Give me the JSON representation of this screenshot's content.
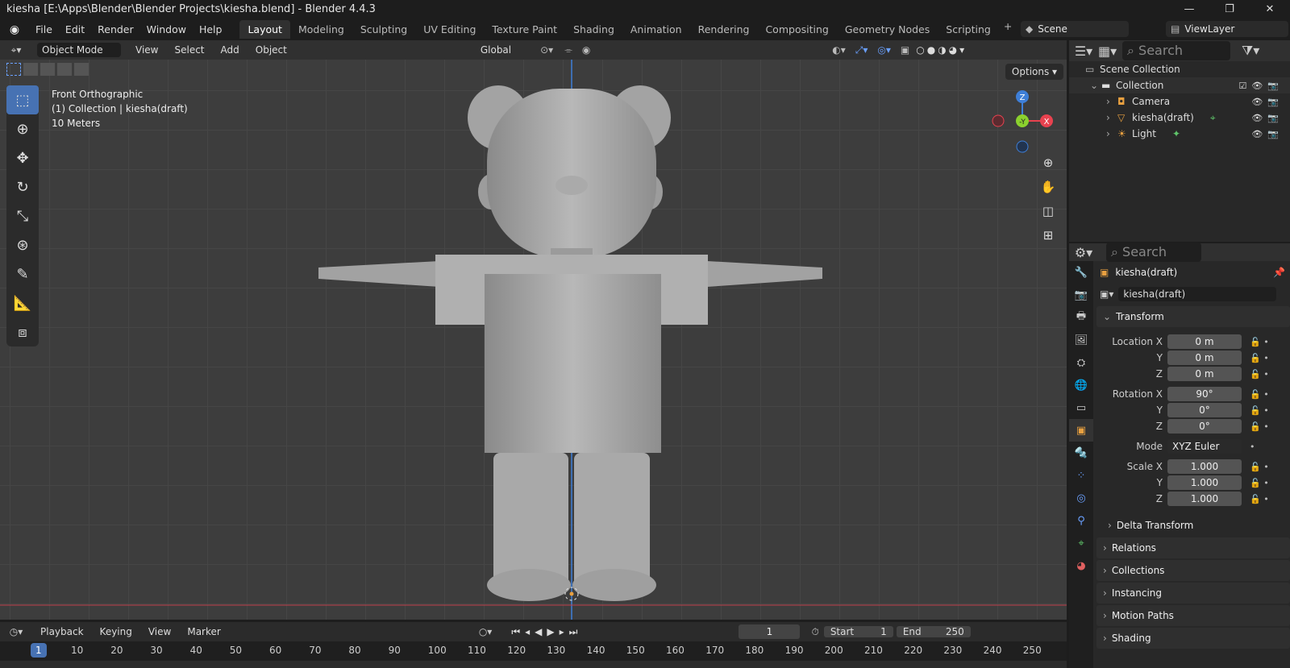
{
  "window": {
    "title": "kiesha [E:\\Apps\\Blender\\Blender Projects\\kiesha.blend] - Blender 4.4.3"
  },
  "menu": [
    "File",
    "Edit",
    "Render",
    "Window",
    "Help"
  ],
  "workspaces": [
    "Layout",
    "Modeling",
    "Sculpting",
    "UV Editing",
    "Texture Paint",
    "Shading",
    "Animation",
    "Rendering",
    "Compositing",
    "Geometry Nodes",
    "Scripting"
  ],
  "scene": "Scene",
  "view_layer": "ViewLayer",
  "viewport": {
    "mode": "Object Mode",
    "menus": [
      "View",
      "Select",
      "Add",
      "Object"
    ],
    "orientation": "Global",
    "options": "Options",
    "info": {
      "view": "Front Orthographic",
      "collection": "(1) Collection | kiesha(draft)",
      "scale": "10 Meters"
    }
  },
  "outliner": {
    "search_placeholder": "Search",
    "root": "Scene Collection",
    "collection": "Collection",
    "items": [
      "Camera",
      "kiesha(draft)",
      "Light"
    ]
  },
  "properties": {
    "search_placeholder": "Search",
    "object_name": "kiesha(draft)",
    "datablock": "kiesha(draft)",
    "transform_label": "Transform",
    "location": {
      "label": "Location X",
      "x": "0 m",
      "y": "0 m",
      "z": "0 m"
    },
    "rotation": {
      "label": "Rotation X",
      "x": "90°",
      "y": "0°",
      "z": "0°"
    },
    "mode_label": "Mode",
    "mode": "XYZ Euler",
    "scale": {
      "label": "Scale X",
      "x": "1.000",
      "y": "1.000",
      "z": "1.000"
    },
    "axis_y": "Y",
    "axis_z": "Z",
    "panels": [
      "Delta Transform",
      "Relations",
      "Collections",
      "Instancing",
      "Motion Paths",
      "Shading"
    ]
  },
  "timeline": {
    "menus": [
      "Playback",
      "Keying",
      "View",
      "Marker"
    ],
    "current_frame": "1",
    "start_label": "Start",
    "start": "1",
    "end_label": "End",
    "end": "250",
    "ticks": [
      "1",
      "10",
      "20",
      "30",
      "40",
      "50",
      "60",
      "70",
      "80",
      "90",
      "100",
      "110",
      "120",
      "130",
      "140",
      "150",
      "160",
      "170",
      "180",
      "190",
      "200",
      "210",
      "220",
      "230",
      "240",
      "250"
    ]
  },
  "colors": {
    "accent": "#4772b3",
    "axis_x": "#e8424f",
    "axis_y": "#8bd12e",
    "axis_z": "#3e7fd8"
  }
}
